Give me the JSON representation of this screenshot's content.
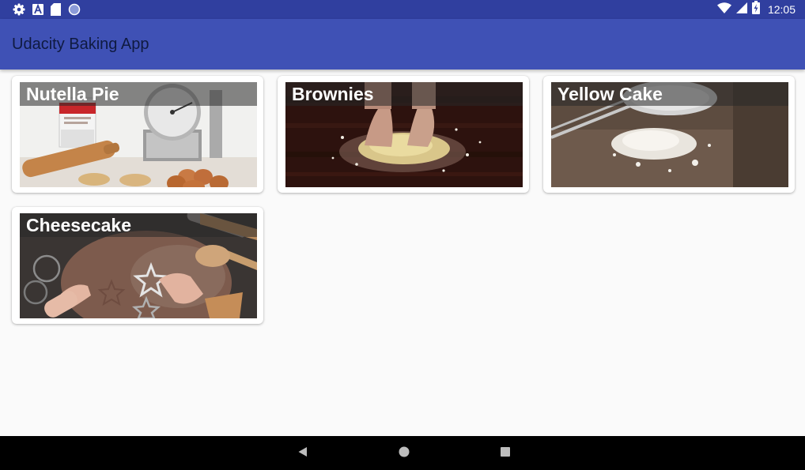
{
  "status_bar": {
    "time": "12:05",
    "left_icons": [
      "gear-icon",
      "font-a-icon",
      "sd-card-icon",
      "circle-icon"
    ],
    "right_icons": [
      "wifi-icon",
      "signal-icon",
      "battery-charging-icon"
    ],
    "color": "#303f9f"
  },
  "app_bar": {
    "title": "Udacity Baking App",
    "color": "#3f51b5"
  },
  "recipes": [
    {
      "name": "Nutella Pie",
      "image": "kitchen-scale-rolling-pin-photo"
    },
    {
      "name": "Brownies",
      "image": "hands-kneading-dough-photo"
    },
    {
      "name": "Yellow Cake",
      "image": "flour-sifter-photo"
    },
    {
      "name": "Cheesecake",
      "image": "cookie-cutters-dough-photo"
    }
  ],
  "nav_bar": {
    "buttons": [
      "back-icon",
      "home-icon",
      "recents-icon"
    ]
  }
}
